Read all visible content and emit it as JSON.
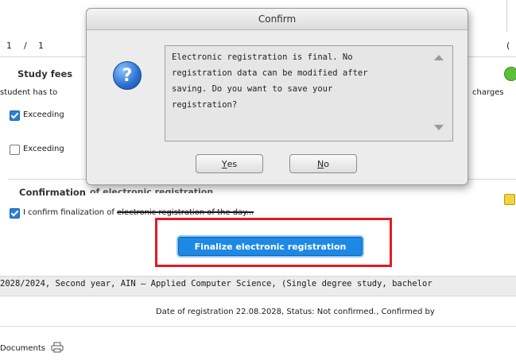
{
  "pager": {
    "current": "1",
    "sep": "/",
    "total": "1"
  },
  "right_top": "(",
  "study_fees": {
    "title": "Study fees",
    "student_has_to": "student has to",
    "charges": "charges",
    "exceeding_1": "Exceeding",
    "exceeding_2": "Exceeding"
  },
  "confirmation": {
    "title": "Confirmation",
    "title_hidden": "of electronic registration",
    "checkbox_label_prefix": "I confirm finalization of",
    "checkbox_label_struck": "electronic registration of the day..."
  },
  "finalize_button": "Finalize electronic registration",
  "study_line": "2028/2024, Second year, AIN – Applied Computer Science, (Single degree study, bachelor",
  "date_line": "Date of registration 22.08.2028, Status: Not confirmed., Confirmed by",
  "documents_label": "Documents",
  "dialog": {
    "title": "Confirm",
    "message_lines": [
      "Electronic registration is final. No",
      "registration data can be modified after",
      "saving. Do you want to save your",
      "registration?"
    ],
    "yes_first": "Y",
    "yes_rest": "es",
    "no_first": "N",
    "no_rest": "o"
  },
  "colors": {
    "accent_button": "#1e88e5",
    "highlight_box": "#e31b23",
    "checkbox": "#2a7fd4"
  }
}
